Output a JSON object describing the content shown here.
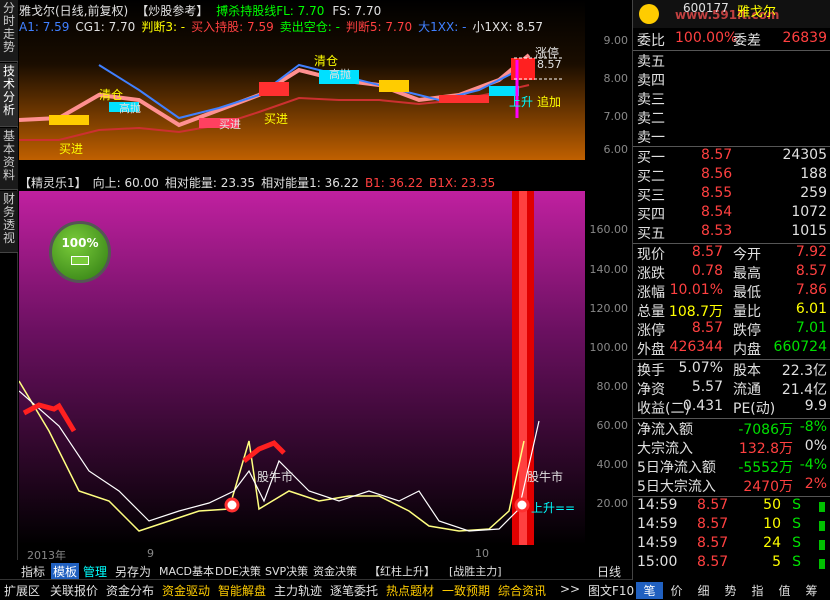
{
  "vtabs": [
    "分时走势",
    "技术分析",
    "基本资料",
    "财务透视"
  ],
  "top": {
    "line1": [
      {
        "text": "雅戈尔(日线,前复权)",
        "color": "#e0e0e0"
      },
      {
        "text": "【炒股参考】",
        "color": "#e0e0e0"
      },
      {
        "text": "搏杀持股线FL: 7.70",
        "color": "#00ff00"
      },
      {
        "text": "FS: 7.70",
        "color": "#e0e0e0"
      }
    ],
    "line2": [
      {
        "text": "A1: 7.59",
        "color": "#4080ff"
      },
      {
        "text": "CG1: 7.70",
        "color": "#e0e0e0"
      },
      {
        "text": "判断3: -",
        "color": "#ffff00"
      },
      {
        "text": "买入持股: 7.59",
        "color": "#ff4040"
      },
      {
        "text": "卖出空仓: -",
        "color": "#00ff00"
      },
      {
        "text": "判断5: 7.70",
        "color": "#ff4040"
      },
      {
        "text": "大1XX: -",
        "color": "#4080ff"
      },
      {
        "text": "小1XX: 8.57",
        "color": "#e0e0e0"
      }
    ],
    "annotations": {
      "qingcang1": "清仓",
      "qingcang2": "清仓",
      "gaopao1": "高抛",
      "gaopao2": "高抛",
      "maijin1": "买进",
      "maijin2": "买进",
      "maijin3": "买进",
      "shangsheng": "上升",
      "zhuijia": "追加",
      "zhangting": "涨停",
      "price857": "8.57"
    },
    "axis": [
      "9.00",
      "8.00",
      "7.00",
      "6.00"
    ]
  },
  "indicator": {
    "items": [
      {
        "text": "【精灵乐1】",
        "color": "#e0e0e0"
      },
      {
        "text": "向上: 60.00",
        "color": "#e0e0e0"
      },
      {
        "text": "相对能量: 23.35",
        "color": "#e0e0e0"
      },
      {
        "text": "相对能量1: 36.22",
        "color": "#e0e0e0"
      },
      {
        "text": "B1: 36.22",
        "color": "#ff4040"
      },
      {
        "text": "B1X: 23.35",
        "color": "#ff4040"
      }
    ],
    "axis": [
      "160.00",
      "140.00",
      "120.00",
      "100.00",
      "80.00",
      "60.00",
      "40.00",
      "20.00"
    ],
    "battery": "100%",
    "labels": {
      "gnsh1": "股牛市",
      "gnsh2": "股牛市",
      "shangsheng": "上升=="
    }
  },
  "xaxis": {
    "year": "2013年",
    "m9": "9",
    "m10": "10"
  },
  "tabbar1": [
    "指标",
    "模板",
    "管理",
    "另存为",
    "MACD基本",
    "DDE决策",
    "SVP决策",
    "资金决策",
    "【红柱上升】",
    "[战胜主力]",
    "日线"
  ],
  "tabbar2": [
    "扩展区",
    "关联报价",
    "资金分布",
    "资金驱动",
    "智能解盘",
    "主力轨迹",
    "逐笔委托",
    "热点题材",
    "一致预期",
    "综合资讯",
    ">>",
    "图文F10"
  ],
  "rtabs": [
    "笔",
    "价",
    "细",
    "势",
    "指",
    "值",
    "筹"
  ],
  "stock": {
    "code": "600177",
    "name": "雅戈尔",
    "watermark": "www.591lt.com"
  },
  "weibi": {
    "label1": "委比",
    "value1": "100.00%",
    "label2": "委差",
    "value2": "26839"
  },
  "sell": [
    {
      "label": "卖五",
      "price": "",
      "vol": ""
    },
    {
      "label": "卖四",
      "price": "",
      "vol": ""
    },
    {
      "label": "卖三",
      "price": "",
      "vol": ""
    },
    {
      "label": "卖二",
      "price": "",
      "vol": ""
    },
    {
      "label": "卖一",
      "price": "",
      "vol": ""
    }
  ],
  "buy": [
    {
      "label": "买一",
      "price": "8.57",
      "vol": "24305"
    },
    {
      "label": "买二",
      "price": "8.56",
      "vol": "188"
    },
    {
      "label": "买三",
      "price": "8.55",
      "vol": "259"
    },
    {
      "label": "买四",
      "price": "8.54",
      "vol": "1072"
    },
    {
      "label": "买五",
      "price": "8.53",
      "vol": "1015"
    }
  ],
  "quote": [
    {
      "l1": "现价",
      "v1": "8.57",
      "c1": "#ff4040",
      "l2": "今开",
      "v2": "7.92",
      "c2": "#ff4040"
    },
    {
      "l1": "涨跌",
      "v1": "0.78",
      "c1": "#ff4040",
      "l2": "最高",
      "v2": "8.57",
      "c2": "#ff4040"
    },
    {
      "l1": "涨幅",
      "v1": "10.01%",
      "c1": "#ff4040",
      "l2": "最低",
      "v2": "7.86",
      "c2": "#ff4040"
    },
    {
      "l1": "总量",
      "v1": "108.7万",
      "c1": "#ffff00",
      "l2": "量比",
      "v2": "6.01",
      "c2": "#ffff00"
    },
    {
      "l1": "涨停",
      "v1": "8.57",
      "c1": "#ff4040",
      "l2": "跌停",
      "v2": "7.01",
      "c2": "#00e000"
    },
    {
      "l1": "外盘",
      "v1": "426344",
      "c1": "#ff4040",
      "l2": "内盘",
      "v2": "660724",
      "c2": "#00e000"
    }
  ],
  "fund": [
    {
      "l1": "换手",
      "v1": "5.07%",
      "l2": "股本",
      "v2": "22.3亿"
    },
    {
      "l1": "净资",
      "v1": "5.57",
      "l2": "流通",
      "v2": "21.4亿"
    },
    {
      "l1": "收益(二)",
      "v1": "0.431",
      "l2": "PE(动)",
      "v2": "9.9"
    }
  ],
  "flow": [
    {
      "label": "净流入额",
      "value": "-7086万",
      "vcolor": "#00e000",
      "pct": "-8%",
      "pcolor": "#00e000"
    },
    {
      "label": "大宗流入",
      "value": "132.8万",
      "vcolor": "#ff4040",
      "pct": "0%",
      "pcolor": "#e0e0e0"
    },
    {
      "label": "5日净流入额",
      "value": "-5552万",
      "vcolor": "#00e000",
      "pct": "-4%",
      "pcolor": "#00e000"
    },
    {
      "label": "5日大宗流入",
      "value": "2470万",
      "vcolor": "#ff4040",
      "pct": "2%",
      "pcolor": "#ff4040"
    }
  ],
  "ticks": [
    {
      "time": "14:59",
      "price": "8.57",
      "vol": "50",
      "side": "S"
    },
    {
      "time": "14:59",
      "price": "8.57",
      "vol": "10",
      "side": "S"
    },
    {
      "time": "14:59",
      "price": "8.57",
      "vol": "24",
      "side": "S"
    },
    {
      "time": "15:00",
      "price": "8.57",
      "vol": "5",
      "side": "S"
    }
  ]
}
